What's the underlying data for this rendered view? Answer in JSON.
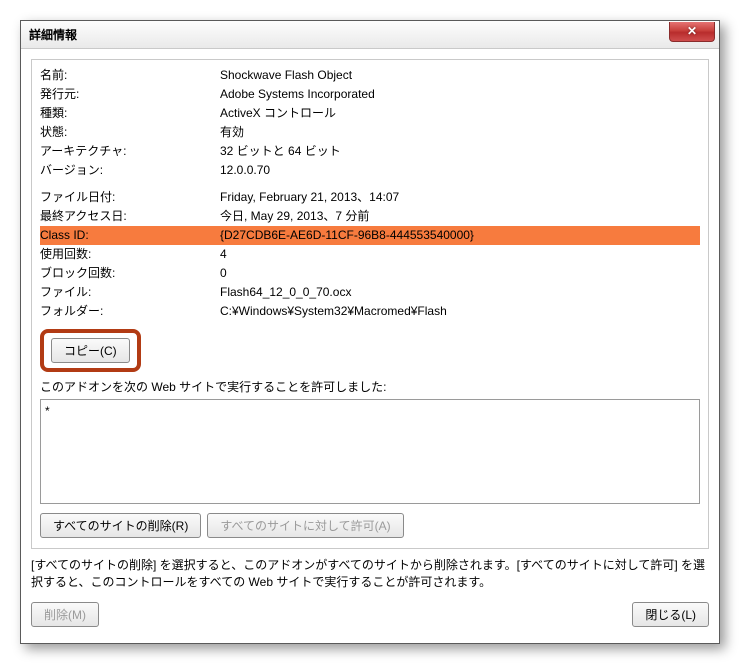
{
  "title": "詳細情報",
  "rows": [
    {
      "label": "名前:",
      "value": "Shockwave Flash Object"
    },
    {
      "label": "発行元:",
      "value": "Adobe Systems Incorporated"
    },
    {
      "label": "種類:",
      "value": "ActiveX コントロール"
    },
    {
      "label": "状態:",
      "value": "有効"
    },
    {
      "label": "アーキテクチャ:",
      "value": "32 ビットと 64 ビット"
    },
    {
      "label": "バージョン:",
      "value": "12.0.0.70"
    }
  ],
  "rows2": [
    {
      "label": "ファイル日付:",
      "value": "Friday, February 21, 2013、14:07"
    },
    {
      "label": "最終アクセス日:",
      "value": "今日, May 29, 2013、7 分前"
    }
  ],
  "hlRow": {
    "label": "Class ID:",
    "value": "{D27CDB6E-AE6D-11CF-96B8-444553540000}"
  },
  "rows3": [
    {
      "label": "使用回数:",
      "value": "4"
    },
    {
      "label": "ブロック回数:",
      "value": "0"
    },
    {
      "label": "ファイル:",
      "value": "Flash64_12_0_0_70.ocx"
    },
    {
      "label": "フォルダー:",
      "value": "C:¥Windows¥System32¥Macromed¥Flash"
    }
  ],
  "copy_btn": "コピー(C)",
  "sites_section": "このアドオンを次の Web サイトで実行することを許可しました:",
  "sites_value": "*",
  "remove_all_btn": "すべてのサイトの削除(R)",
  "allow_all_btn": "すべてのサイトに対して許可(A)",
  "help_text": "[すべてのサイトの削除] を選択すると、このアドオンがすべてのサイトから削除されます。[すべてのサイトに対して許可] を選択すると、このコントロールをすべての Web サイトで実行することが許可されます。",
  "delete_btn": "削除(M)",
  "close_btn_label": "閉じる(L)"
}
